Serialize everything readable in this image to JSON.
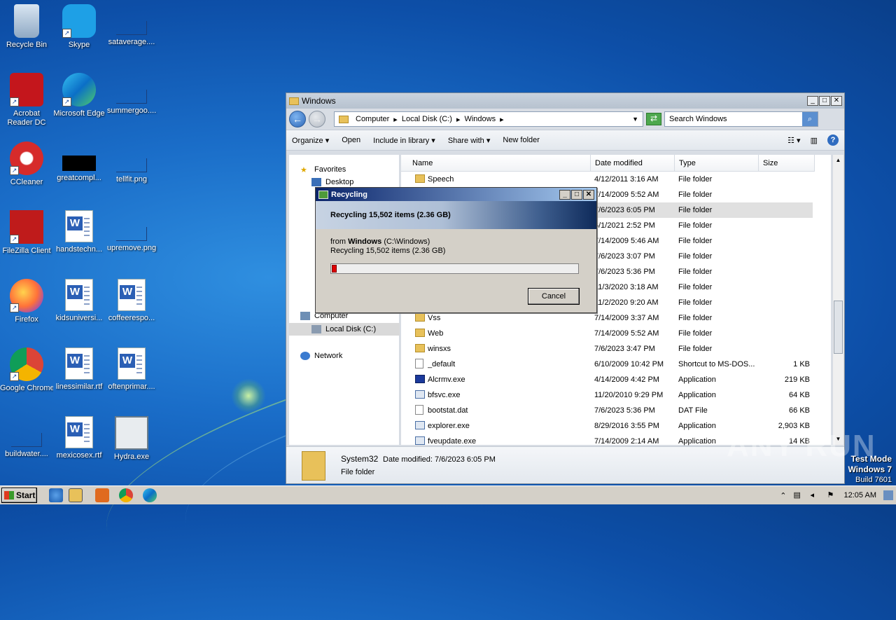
{
  "desktop": {
    "icons": [
      {
        "label": "Recycle Bin"
      },
      {
        "label": "Skype"
      },
      {
        "label": "sataverage...."
      },
      {
        "label": "Acrobat Reader DC"
      },
      {
        "label": "Microsoft Edge"
      },
      {
        "label": "summergoo...."
      },
      {
        "label": "CCleaner"
      },
      {
        "label": "greatcompl..."
      },
      {
        "label": "tellfit.png"
      },
      {
        "label": "FileZilla Client"
      },
      {
        "label": "handstechn..."
      },
      {
        "label": "upremove.png"
      },
      {
        "label": "Firefox"
      },
      {
        "label": "kidsuniversi..."
      },
      {
        "label": "coffeerespo..."
      },
      {
        "label": "Google Chrome"
      },
      {
        "label": "linessimilar.rtf"
      },
      {
        "label": "oftenprimar...."
      },
      {
        "label": "buildwater...."
      },
      {
        "label": "mexicosex.rtf"
      },
      {
        "label": "Hydra.exe"
      }
    ]
  },
  "explorer": {
    "title": "Windows",
    "breadcrumb": [
      "Computer",
      "Local Disk (C:)",
      "Windows"
    ],
    "search_placeholder": "Search Windows",
    "commands": [
      "Organize",
      "Open",
      "Include in library",
      "Share with",
      "New folder"
    ],
    "nav": {
      "favorites": "Favorites",
      "desktop": "Desktop",
      "computer": "Computer",
      "local_disk": "Local Disk (C:)",
      "network": "Network"
    },
    "columns": [
      "Name",
      "Date modified",
      "Type",
      "Size"
    ],
    "rows": [
      {
        "name": "Speech",
        "date": "4/12/2011 3:16 AM",
        "type": "File folder",
        "size": ""
      },
      {
        "name": "",
        "date": "7/14/2009 5:52 AM",
        "type": "File folder",
        "size": ""
      },
      {
        "name": "",
        "date": "7/6/2023 6:05 PM",
        "type": "File folder",
        "size": ""
      },
      {
        "name": "",
        "date": "6/1/2021 2:52 PM",
        "type": "File folder",
        "size": ""
      },
      {
        "name": "",
        "date": "7/14/2009 5:46 AM",
        "type": "File folder",
        "size": ""
      },
      {
        "name": "",
        "date": "7/6/2023 3:07 PM",
        "type": "File folder",
        "size": ""
      },
      {
        "name": "",
        "date": "7/6/2023 5:36 PM",
        "type": "File folder",
        "size": ""
      },
      {
        "name": "",
        "date": "11/3/2020 3:18 AM",
        "type": "File folder",
        "size": ""
      },
      {
        "name": "",
        "date": "11/2/2020 9:20 AM",
        "type": "File folder",
        "size": ""
      },
      {
        "name": "Vss",
        "date": "7/14/2009 3:37 AM",
        "type": "File folder",
        "size": ""
      },
      {
        "name": "Web",
        "date": "7/14/2009 5:52 AM",
        "type": "File folder",
        "size": ""
      },
      {
        "name": "winsxs",
        "date": "7/6/2023 3:47 PM",
        "type": "File folder",
        "size": ""
      },
      {
        "name": "_default",
        "date": "6/10/2009 10:42 PM",
        "type": "Shortcut to MS-DOS...",
        "size": "1 KB"
      },
      {
        "name": "Alcrmv.exe",
        "date": "4/14/2009 4:42 PM",
        "type": "Application",
        "size": "219 KB"
      },
      {
        "name": "bfsvc.exe",
        "date": "11/20/2010 9:29 PM",
        "type": "Application",
        "size": "64 KB"
      },
      {
        "name": "bootstat.dat",
        "date": "7/6/2023 5:36 PM",
        "type": "DAT File",
        "size": "66 KB"
      },
      {
        "name": "explorer.exe",
        "date": "8/29/2016 3:55 PM",
        "type": "Application",
        "size": "2,903 KB"
      },
      {
        "name": "fveupdate.exe",
        "date": "7/14/2009 2:14 AM",
        "type": "Application",
        "size": "14 KB"
      }
    ],
    "details": {
      "name": "System32",
      "date_label": "Date modified: 7/6/2023 6:05 PM",
      "type": "File folder"
    }
  },
  "dialog": {
    "title": "Recycling",
    "heading": "Recycling 15,502 items (2.36 GB)",
    "from_prefix": "from",
    "from_name": "Windows",
    "from_path": "(C:\\Windows)",
    "status": "Recycling 15,502 items (2.36 GB)",
    "progress_fraction": 0.02,
    "cancel": "Cancel"
  },
  "watermark": {
    "text": "ANY RUN",
    "mode": "Test Mode",
    "os": "Windows 7",
    "build": "Build 7601"
  },
  "taskbar": {
    "start": "Start",
    "time": "12:05 AM"
  }
}
